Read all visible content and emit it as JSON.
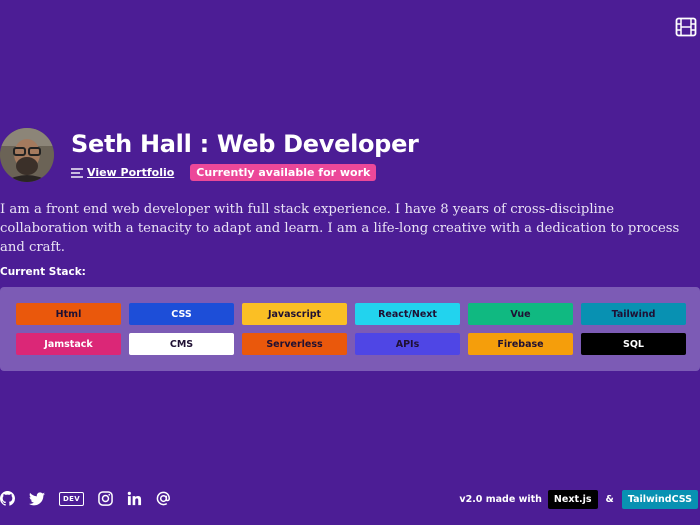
{
  "header": {
    "name": "Seth Hall : Web Developer",
    "portfolio_link": "View Portfolio",
    "availability": "Currently available for work"
  },
  "bio": "I am a front end web developer with full stack experience. I have 8 years of cross-discipline collaboration with a tenacity to adapt and learn. I am a life-long creative with a dedication to process and craft.",
  "stack": {
    "title": "Current Stack:",
    "items": [
      {
        "label": "Html",
        "color": "#ea580c",
        "text": "dark"
      },
      {
        "label": "CSS",
        "color": "#1d4ed8",
        "text": "light"
      },
      {
        "label": "Javascript",
        "color": "#fbbf24",
        "text": "dark"
      },
      {
        "label": "React/Next",
        "color": "#22d3ee",
        "text": "dark"
      },
      {
        "label": "Vue",
        "color": "#10b981",
        "text": "dark"
      },
      {
        "label": "Tailwind",
        "color": "#0891b2",
        "text": "dark"
      },
      {
        "label": "Jamstack",
        "color": "#db2777",
        "text": "light"
      },
      {
        "label": "CMS",
        "color": "#ffffff",
        "text": "dark"
      },
      {
        "label": "Serverless",
        "color": "#ea580c",
        "text": "dark"
      },
      {
        "label": "APIs",
        "color": "#4f46e5",
        "text": "dark"
      },
      {
        "label": "Firebase",
        "color": "#f59e0b",
        "text": "dark"
      },
      {
        "label": "SQL",
        "color": "#000000",
        "text": "light"
      }
    ]
  },
  "footer": {
    "socials": [
      "github-icon",
      "twitter-icon",
      "dev-icon",
      "instagram-icon",
      "linkedin-icon",
      "email-icon"
    ],
    "dev_label": "DEV",
    "made_with": "v2.0 made with",
    "nextjs": "Next.js",
    "amp": "&",
    "tailwind": "TailwindCSS"
  },
  "colors": {
    "background": "#4c1d95",
    "panel": "#7c5bb5",
    "badge_pink": "#ec4899"
  }
}
